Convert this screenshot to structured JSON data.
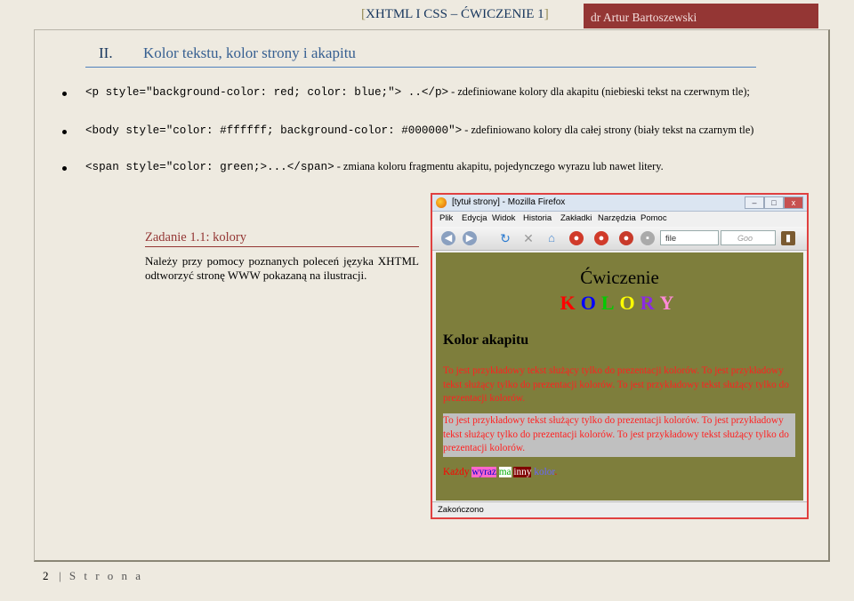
{
  "header": {
    "title": "XHTML I CSS – ĆWICZENIE 1",
    "bracket_open": "[",
    "bracket_close": "]",
    "author": "dr Artur Bartoszewski"
  },
  "section": {
    "number": "II.",
    "title": "Kolor tekstu, kolor strony i akapitu"
  },
  "bullets": [
    {
      "code": "<p style=\"background-color: red; color: blue;\"> ..</p>",
      "text": " - zdefiniowane kolory dla akapitu (niebieski tekst na czerwnym tle);"
    },
    {
      "code": "<body style=\"color: #ffffff; background-color: #000000\">",
      "text": " - zdefiniowano kolory dla całej strony (biały tekst na czarnym tle)"
    },
    {
      "code": "<span style=\"color: green;>...</span>",
      "text": " - zmiana koloru fragmentu akapitu, pojedynczego wyrazu lub nawet litery."
    }
  ],
  "task": {
    "title": "Zadanie 1.1: kolory",
    "text": "Należy przy pomocy poznanych poleceń języka XHTML odtworzyć stronę WWW pokazaną na ilustracji."
  },
  "browser": {
    "window_title": "[tytuł strony] - Mozilla Firefox",
    "menu": [
      "Plik",
      "Edycja",
      "Widok",
      "Historia",
      "Zakładki",
      "Narzędzia",
      "Pomoc"
    ],
    "url_text": "file",
    "search_placeholder": "Goo",
    "status": "Zakończono",
    "window_buttons": [
      "–",
      "□",
      "x"
    ],
    "page": {
      "title": "Ćwiczenie",
      "kolory_letters": [
        {
          "ch": "K",
          "color": "#ff0000"
        },
        {
          "ch": "O",
          "color": "#0000ff"
        },
        {
          "ch": "L",
          "color": "#00cc00"
        },
        {
          "ch": "O",
          "color": "#ffff00"
        },
        {
          "ch": "R",
          "color": "#8a2be2"
        },
        {
          "ch": "Y",
          "color": "#ff8ad8"
        }
      ],
      "heading": "Kolor akapitu",
      "paragraph": "To jest przykładowy tekst służący tylko do prezentacji kolorów. To jest przykładowy tekst służący tylko do prezentacji kolorów. To jest przykładowy tekst służący tylko do prezentacji kolorów.",
      "paragraph2": "To jest przykładowy tekst służący tylko do prezentacji kolorów. To jest przykładowy tekst służący tylko do prezentacji kolorów. To jest przykładowy tekst służący tylko do prezentacji kolorów.",
      "words": [
        {
          "w": "Każdy",
          "color": "#ff0000",
          "bg": "transparent"
        },
        {
          "w": "wyraz",
          "color": "#0000cc",
          "bg": "#ff66cc"
        },
        {
          "w": "ma",
          "color": "#00aa00",
          "bg": "#ffffff"
        },
        {
          "w": "inny",
          "color": "#ffffff",
          "bg": "#800000"
        },
        {
          "w": "kolor",
          "color": "#6666ff",
          "bg": "transparent"
        },
        {
          "w": ".",
          "color": "#ff0000",
          "bg": "transparent"
        }
      ]
    }
  },
  "footer": {
    "page_number": "2",
    "label": "| S t r o n a"
  }
}
